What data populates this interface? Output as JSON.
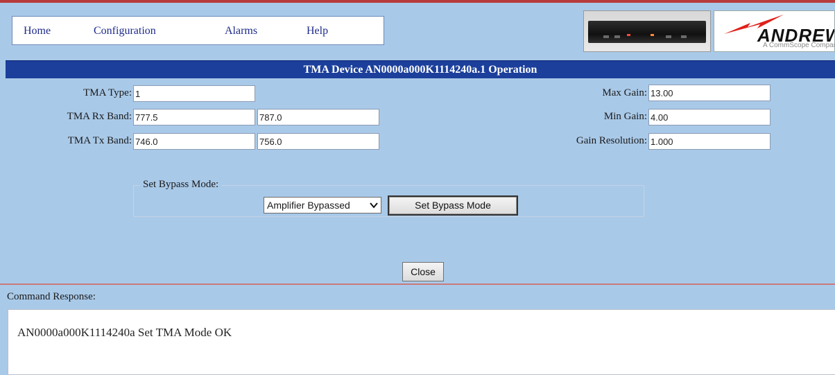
{
  "nav": {
    "items": [
      {
        "label": "Home"
      },
      {
        "label": "Configuration"
      },
      {
        "label": "Alarms"
      },
      {
        "label": "Help"
      }
    ]
  },
  "branding": {
    "logo_name": "ANDREW",
    "logo_sub": "A CommScope Company",
    "device_image": "tma-controller-rack-unit"
  },
  "title": "TMA Device AN0000a000K1114240a.1 Operation",
  "fields": {
    "tma_type": {
      "label": "TMA Type:",
      "value": "1"
    },
    "rx_band": {
      "label": "TMA Rx Band:",
      "low": "777.5",
      "high": "787.0"
    },
    "tx_band": {
      "label": "TMA Tx Band:",
      "low": "746.0",
      "high": "756.0"
    },
    "max_gain": {
      "label": "Max Gain:",
      "value": "13.00"
    },
    "min_gain": {
      "label": "Min Gain:",
      "value": "4.00"
    },
    "gain_resolution": {
      "label": "Gain Resolution:",
      "value": "1.000"
    }
  },
  "bypass": {
    "legend": "Set Bypass Mode:",
    "selected": "Amplifier Bypassed",
    "button_label": "Set Bypass Mode"
  },
  "close_label": "Close",
  "response": {
    "label": "Command Response:",
    "text": "AN0000a000K1114240a Set TMA Mode OK"
  },
  "colors": {
    "background": "#a9c9e8",
    "title_bar": "#1b3f9b",
    "nav_link": "#1d2a8a",
    "accent_red": "#b83a3a"
  }
}
